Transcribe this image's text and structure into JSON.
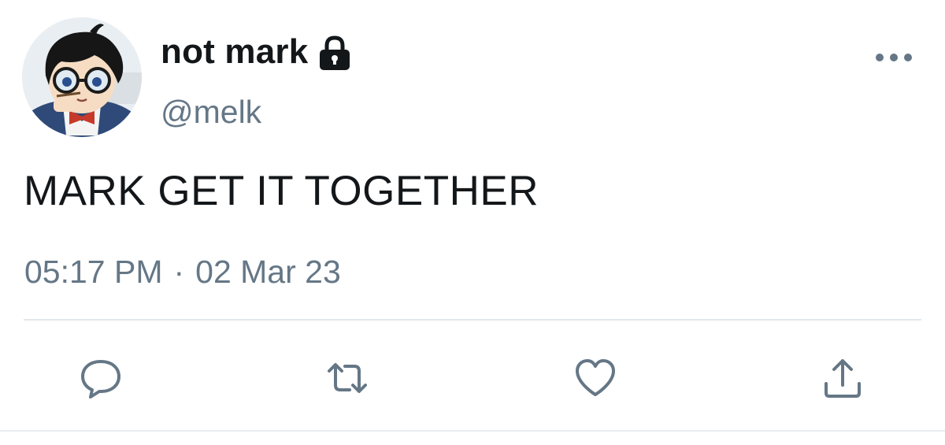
{
  "user": {
    "display_name": "not mark",
    "handle": "@melk",
    "protected_icon": "lock-icon",
    "avatar_icon": "avatar"
  },
  "tweet": {
    "text": "MARK GET IT TOGETHER",
    "time": "05:17 PM",
    "separator": "·",
    "date": "02 Mar 23"
  },
  "actions": {
    "reply_icon": "reply-icon",
    "retweet_icon": "retweet-icon",
    "like_icon": "heart-icon",
    "share_icon": "share-icon",
    "more_icon": "more-icon"
  },
  "colors": {
    "text_primary": "#14171a",
    "text_secondary": "#657786",
    "icon_color": "#657786",
    "divider": "#e1e8ed",
    "background": "#ffffff"
  }
}
